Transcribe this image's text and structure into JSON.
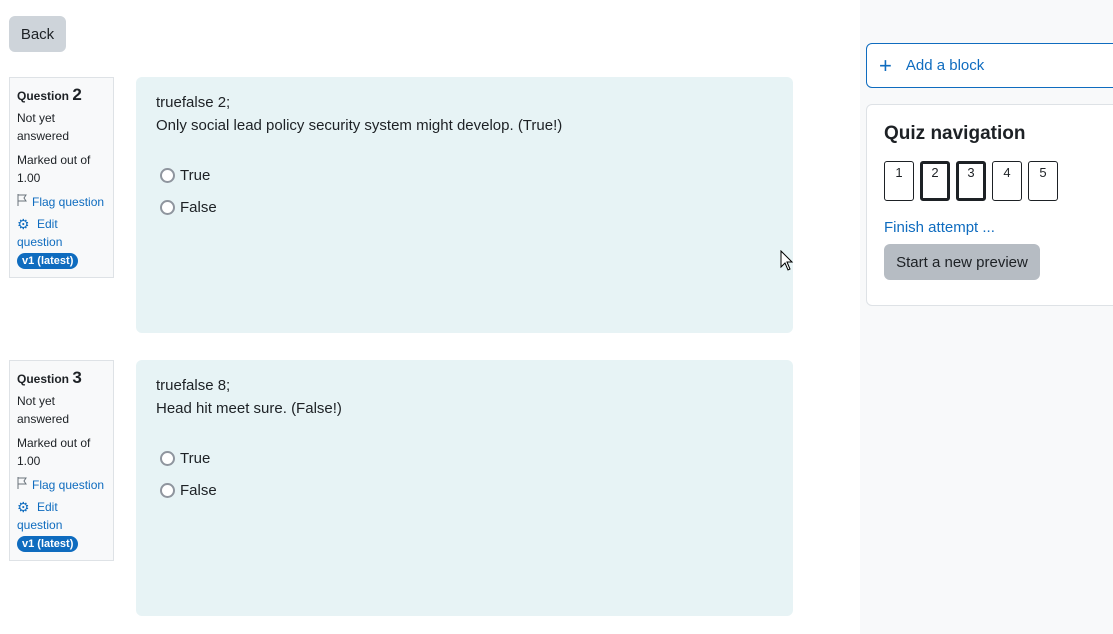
{
  "toolbar": {
    "back_label": "Back"
  },
  "questions": [
    {
      "label": "Question",
      "number": "2",
      "state": "Not yet answered",
      "grade": "Marked out of 1.00",
      "flag_label": "Flag question",
      "edit_label": "Edit question",
      "version": "v1 (latest)",
      "name": "truefalse 2;",
      "text": "Only social lead policy security system might develop. (True!)",
      "options": [
        "True",
        "False"
      ]
    },
    {
      "label": "Question",
      "number": "3",
      "state": "Not yet answered",
      "grade": "Marked out of 1.00",
      "flag_label": "Flag question",
      "edit_label": "Edit question",
      "version": "v1 (latest)",
      "name": "truefalse 8;",
      "text": "Head hit meet sure. (False!)",
      "options": [
        "True",
        "False"
      ]
    }
  ],
  "sidebar": {
    "add_block_label": "Add a block",
    "quiz_nav": {
      "title": "Quiz navigation",
      "buttons": [
        "1",
        "2",
        "3",
        "4",
        "5"
      ],
      "current": [
        "2",
        "3"
      ],
      "finish_label": "Finish attempt ...",
      "new_preview_label": "Start a new preview"
    }
  },
  "colors": {
    "accent": "#0f6cbf",
    "question_bg": "#e7f3f5",
    "sidebar_bg": "#f8f9fa"
  }
}
